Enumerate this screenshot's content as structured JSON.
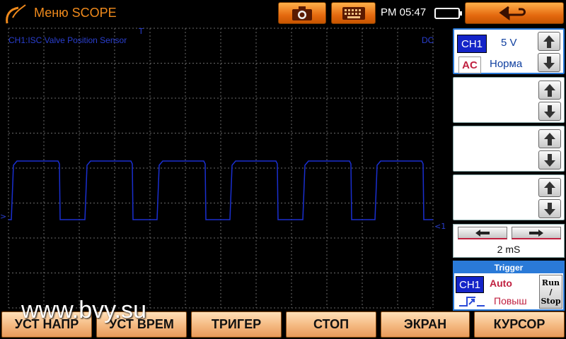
{
  "titlebar": {
    "title": "Меню SCOPE",
    "clock": "PM 05:47",
    "icons": {
      "camera": "camera-icon",
      "keyboard": "keyboard-icon",
      "back": "back-arrow-icon",
      "battery": "battery-icon"
    }
  },
  "scope": {
    "channel_label": "CH1:ISC Valve Position Sensor",
    "coupling_label": "DC",
    "trigger_marker": "T",
    "level_marker_left": ">",
    "level_marker_right": "<1",
    "trace_color": "#1a2fd0",
    "grid_color": "#6a6a6a"
  },
  "channels": [
    {
      "badge": "CH1",
      "volts": "5 V",
      "coupling": "AC",
      "mode": "Норма",
      "active": true
    },
    {
      "badge": "",
      "volts": "",
      "coupling": "",
      "mode": "",
      "active": false
    },
    {
      "badge": "",
      "volts": "",
      "coupling": "",
      "mode": "",
      "active": false
    },
    {
      "badge": "",
      "volts": "",
      "coupling": "",
      "mode": "",
      "active": false
    }
  ],
  "timebase": {
    "value": "2 mS"
  },
  "trigger": {
    "header": "Trigger",
    "channel": "CH1",
    "mode": "Auto",
    "slope": "Повыш",
    "run_stop": [
      "Run",
      "/",
      "Stop"
    ]
  },
  "bottom_buttons": [
    "УСТ НАПР",
    "УСТ ВРЕМ",
    "ТРИГЕР",
    "СТОП",
    "ЭКРАН",
    "КУРСОР"
  ],
  "watermark": "www.bvy.su",
  "colors": {
    "accent_orange": "#f08a1c",
    "active_blue": "#2a7ad8",
    "badge_blue": "#1424c8",
    "warn_red": "#c02040"
  }
}
